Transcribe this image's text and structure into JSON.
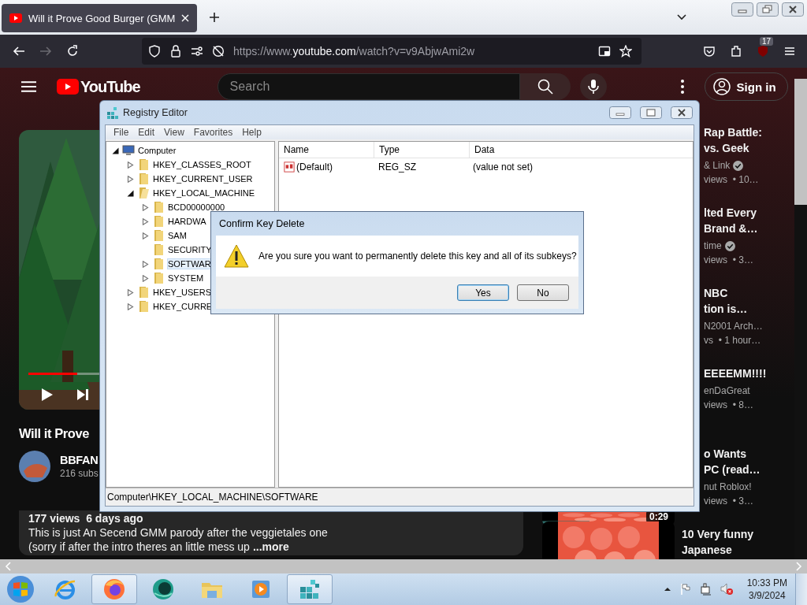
{
  "browser": {
    "tab": {
      "title": "Will it Prove Good Burger (GMM",
      "selected": true
    },
    "url": {
      "prefix": "https://www.",
      "host": "youtube.com",
      "path": "/watch?v=v9AbjwAmi2w"
    },
    "forward_disabled": true,
    "extension_badge": "17"
  },
  "youtube": {
    "logo": "YouTube",
    "search": {
      "placeholder": "Search"
    },
    "sign_in": "Sign in",
    "video": {
      "title": "Will it Prove",
      "progress": {
        "level": 0.1
      }
    },
    "channel": {
      "name": "BBFAN",
      "subscribers": "216 subs"
    },
    "description": {
      "stats": "177 views  6 days ago",
      "lines": [
        "This is just An Secend GMM parody after the veggietales one",
        "(sorry if after the intro theres an little mess up"
      ],
      "more": "...more"
    },
    "sidebar": [
      {
        "clipped": true,
        "thumbnail": false,
        "title_lines": [
          "Rap Battle:",
          "vs. Geek"
        ],
        "channel": "& Link",
        "verified": true,
        "meta": "views  • 10…"
      },
      {
        "clipped": true,
        "thumbnail": false,
        "title_lines": [
          "lted Every",
          "Brand &…"
        ],
        "channel": "time",
        "verified": true,
        "meta": "views  • 3…"
      },
      {
        "clipped": true,
        "thumbnail": false,
        "title_lines": [
          "NBC",
          "tion is…"
        ],
        "channel": "N2001 Arch…",
        "verified": false,
        "meta": "vs  • 1 hour…"
      },
      {
        "clipped": true,
        "thumbnail": false,
        "title_lines": [
          "EEEEMM!!!!"
        ],
        "channel": "enDaGreat",
        "verified": false,
        "meta": "views  • 8…"
      },
      {
        "clipped": true,
        "thumbnail": true,
        "duration": "0:29",
        "title_lines": [
          "o Wants",
          "PC (read…"
        ],
        "channel": "nut Roblox!",
        "verified": false,
        "meta": "views  • 3…"
      },
      {
        "clipped": false,
        "thumbnail": true,
        "title_lines": [
          "10 Very funny",
          "Japanese"
        ]
      }
    ]
  },
  "registry": {
    "title": "Registry Editor",
    "menu": [
      "File",
      "Edit",
      "View",
      "Favorites",
      "Help"
    ],
    "tree": [
      {
        "label": "Computer",
        "kind": "computer",
        "expandable": true,
        "expanded": true,
        "selected": false,
        "children": [
          {
            "label": "HKEY_CLASSES_ROOT",
            "kind": "folder",
            "expandable": true,
            "expanded": false,
            "selected": false
          },
          {
            "label": "HKEY_CURRENT_USER",
            "kind": "folder",
            "expandable": true,
            "expanded": false,
            "selected": false
          },
          {
            "label": "HKEY_LOCAL_MACHINE",
            "kind": "folder",
            "expandable": true,
            "expanded": true,
            "selected": false,
            "children": [
              {
                "label": "BCD00000000",
                "kind": "folder",
                "expandable": true,
                "expanded": false,
                "selected": false
              },
              {
                "label": "HARDWA",
                "kind": "folder",
                "expandable": true,
                "expanded": false,
                "selected": false
              },
              {
                "label": "SAM",
                "kind": "folder",
                "expandable": true,
                "expanded": false,
                "selected": false
              },
              {
                "label": "SECURITY",
                "kind": "folder",
                "expandable": false,
                "expanded": false,
                "selected": false
              },
              {
                "label": "SOFTWAR",
                "kind": "folder",
                "expandable": true,
                "expanded": false,
                "selected": true
              },
              {
                "label": "SYSTEM",
                "kind": "folder",
                "expandable": true,
                "expanded": false,
                "selected": false
              }
            ]
          },
          {
            "label": "HKEY_USERS",
            "kind": "folder",
            "expandable": true,
            "expanded": false,
            "selected": false
          },
          {
            "label": "HKEY_CURRE",
            "kind": "folder",
            "expandable": true,
            "expanded": false,
            "selected": false
          }
        ]
      }
    ],
    "columns": [
      "Name",
      "Type",
      "Data"
    ],
    "values": [
      {
        "name": "(Default)",
        "type": "REG_SZ",
        "data": "(value not set)"
      }
    ],
    "status": "Computer\\HKEY_LOCAL_MACHINE\\SOFTWARE"
  },
  "dialog": {
    "title": "Confirm Key Delete",
    "message": "Are you sure you want to permanently delete this key and all of its subkeys?",
    "buttons": [
      {
        "label": "Yes",
        "default": true
      },
      {
        "label": "No",
        "default": false
      }
    ]
  },
  "taskbar": {
    "apps": [
      {
        "kind": "ie",
        "active": false
      },
      {
        "kind": "firefox",
        "active": true
      },
      {
        "kind": "globe",
        "active": false
      },
      {
        "kind": "explorer",
        "active": false
      },
      {
        "kind": "media",
        "active": false
      },
      {
        "kind": "regedit",
        "active": true
      }
    ],
    "time": "10:33 PM",
    "date": "3/9/2024"
  }
}
